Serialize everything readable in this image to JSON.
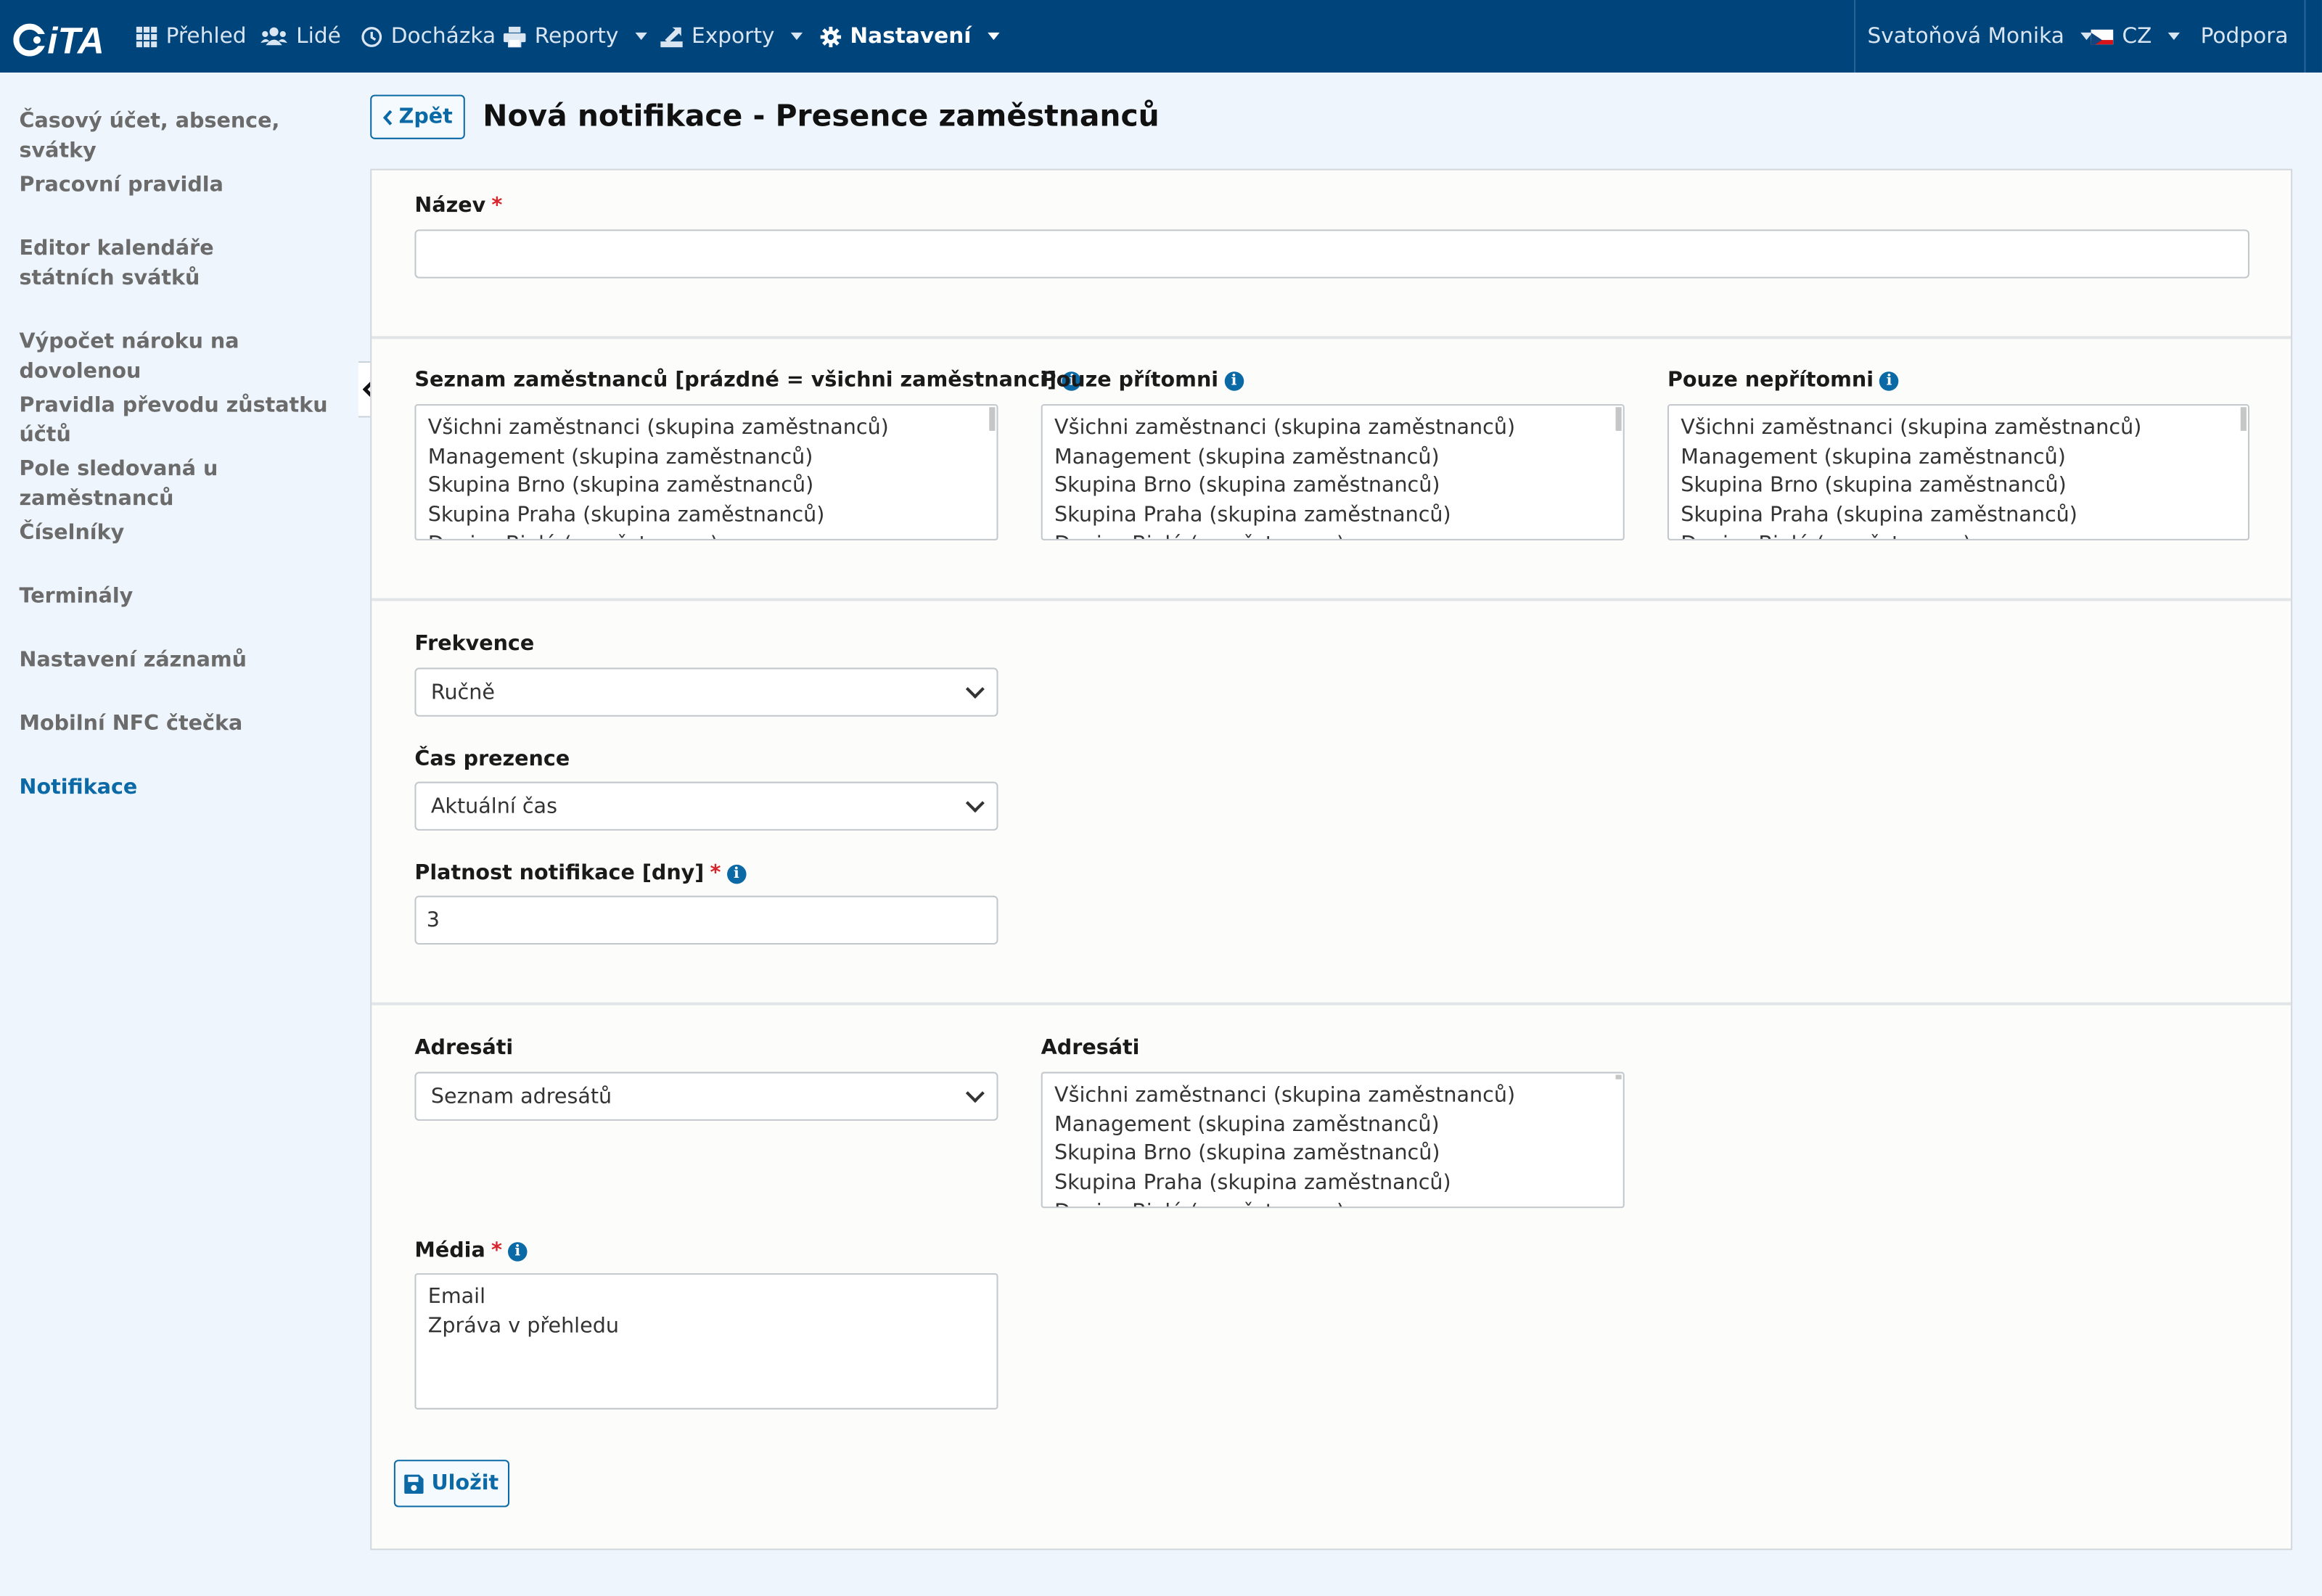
{
  "topbar": {
    "logo_text": "iTA",
    "nav": [
      {
        "label": "Přehled",
        "icon": "grid-icon"
      },
      {
        "label": "Lidé",
        "icon": "users-icon"
      },
      {
        "label": "Docházka",
        "icon": "clock-icon"
      },
      {
        "label": "Reporty",
        "icon": "printer-icon"
      },
      {
        "label": "Exporty",
        "icon": "export-icon"
      },
      {
        "label": "Nastavení",
        "icon": "gear-icon",
        "active": true
      }
    ],
    "user": "Svatoňová Monika",
    "language": "CZ",
    "support": "Podpora"
  },
  "sidebar": {
    "items": [
      {
        "label": "Časový účet, absence, svátky"
      },
      {
        "label": "Pracovní pravidla"
      },
      {
        "label": "Editor kalendáře státních svátků"
      },
      {
        "label": "Výpočet nároku na dovolenou"
      },
      {
        "label": "Pravidla převodu zůstatku účtů"
      },
      {
        "label": "Pole sledovaná u zaměstnanců"
      },
      {
        "label": "Číselníky"
      },
      {
        "label": "Terminály"
      },
      {
        "label": "Nastavení záznamů"
      },
      {
        "label": "Mobilní NFC čtečka"
      },
      {
        "label": "Notifikace",
        "active": true
      }
    ]
  },
  "header": {
    "back_label": "Zpět",
    "title": "Nová notifikace - Presence zaměstnanců"
  },
  "form": {
    "name": {
      "label": "Název",
      "required": "*",
      "value": ""
    },
    "employees": {
      "label": "Seznam zaměstnanců [prázdné = všichni zaměstnanci]",
      "options": [
        "Všichni zaměstnanci (skupina zaměstnanců)",
        "Management (skupina zaměstnanců)",
        "Skupina Brno (skupina zaměstnanců)",
        "Skupina Praha (skupina zaměstnanců)",
        "Denisa Bielá (zaměstnanec)"
      ]
    },
    "present_only": {
      "label": "Pouze přítomni",
      "options": [
        "Všichni zaměstnanci (skupina zaměstnanců)",
        "Management (skupina zaměstnanců)",
        "Skupina Brno (skupina zaměstnanců)",
        "Skupina Praha (skupina zaměstnanců)",
        "Denisa Bielá (zaměstnanec)"
      ]
    },
    "absent_only": {
      "label": "Pouze nepřítomni",
      "options": [
        "Všichni zaměstnanci (skupina zaměstnanců)",
        "Management (skupina zaměstnanců)",
        "Skupina Brno (skupina zaměstnanců)",
        "Skupina Praha (skupina zaměstnanců)",
        "Denisa Bielá (zaměstnanec)"
      ]
    },
    "frequency": {
      "label": "Frekvence",
      "value": "Ručně"
    },
    "presence_time": {
      "label": "Čas prezence",
      "value": "Aktuální čas"
    },
    "validity": {
      "label": "Platnost notifikace [dny]",
      "required": "*",
      "value": "3"
    },
    "recipients_type": {
      "label": "Adresáti",
      "value": "Seznam adresátů"
    },
    "recipients_list": {
      "label": "Adresáti",
      "options": [
        "Všichni zaměstnanci (skupina zaměstnanců)",
        "Management (skupina zaměstnanců)",
        "Skupina Brno (skupina zaměstnanců)",
        "Skupina Praha (skupina zaměstnanců)",
        "Denisa Bielá (zaměstnanec)"
      ]
    },
    "media": {
      "label": "Média",
      "required": "*",
      "options": [
        "Email",
        "Zpráva v přehledu"
      ]
    },
    "save_label": "Uložit"
  },
  "colors": {
    "topbar": "#00447c",
    "accent": "#0b6aa6",
    "required": "#d8232a",
    "background": "#eef5fc"
  }
}
